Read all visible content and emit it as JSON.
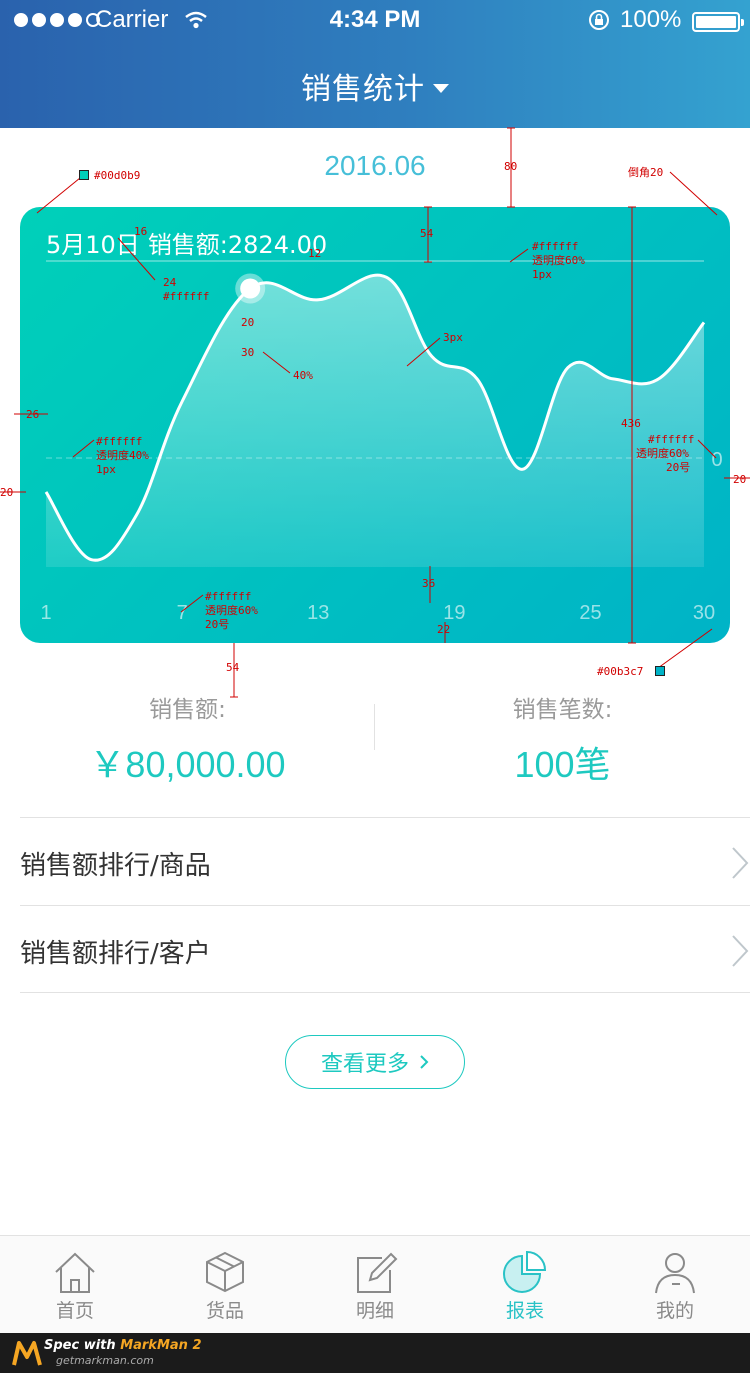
{
  "status_bar": {
    "carrier": "Carrier",
    "time": "4:34 PM",
    "battery": "100%"
  },
  "header": {
    "title": "销售统计"
  },
  "month": "2016.06",
  "chart_card": {
    "date": "5月10日",
    "sales_label": "销售额:2824.00",
    "zero_label": "0",
    "colors": {
      "gradient_start": "#00d0b9",
      "gradient_end": "#00b3c7"
    }
  },
  "chart_data": {
    "type": "area",
    "x_ticks": [
      "1",
      "7",
      "13",
      "19",
      "25",
      "30"
    ],
    "x": [
      1,
      3,
      5,
      7,
      10,
      13,
      16,
      18,
      20,
      22,
      24,
      26,
      28,
      30
    ],
    "values": [
      -0.3,
      -0.9,
      -0.5,
      0.5,
      1.5,
      1.4,
      1.6,
      0.9,
      0.7,
      -0.1,
      0.8,
      0.7,
      0.7,
      1.2
    ],
    "highlight_x": 10,
    "baseline": 0
  },
  "summary": {
    "amount_label": "销售额:",
    "amount_value": "￥80,000.00",
    "count_label": "销售笔数:",
    "count_value": "100笔"
  },
  "list": [
    {
      "label": "销售额排行/商品"
    },
    {
      "label": "销售额排行/客户"
    }
  ],
  "more_button": "查看更多",
  "tabs": [
    {
      "label": "首页",
      "icon": "home-icon"
    },
    {
      "label": "货品",
      "icon": "box-icon"
    },
    {
      "label": "明细",
      "icon": "edit-icon"
    },
    {
      "label": "报表",
      "icon": "pie-chart-icon",
      "active": true
    },
    {
      "label": "我的",
      "icon": "user-icon"
    }
  ],
  "watermark": {
    "title": "Spec with",
    "brand": "MarkMan 2",
    "url": "getmarkman.com"
  },
  "annotations": {
    "color_top": "#00d0b9",
    "radius": "倒角20",
    "n80": "80",
    "n54a": "54",
    "n16": "16",
    "n12": "12",
    "n24": "24",
    "white_a": "#ffffff",
    "white_b": "#ffffff",
    "opacity60_a": "透明度60%",
    "px1_a": "1px",
    "n20a": "20",
    "n30": "30",
    "pct40": "40%",
    "px3": "3px",
    "n26": "26",
    "white_c": "#ffffff",
    "opacity40": "透明度40%",
    "px1_b": "1px",
    "n436": "436",
    "white_d": "#ffffff",
    "opacity60_b": "透明度60%",
    "size20_a": "20号",
    "n20b": "20",
    "n20c": "20",
    "n36": "36",
    "white_e": "#ffffff",
    "opacity60_c": "透明度60%",
    "size20_b": "20号",
    "n22": "22",
    "n54b": "54",
    "color_bottom": "#00b3c7"
  }
}
